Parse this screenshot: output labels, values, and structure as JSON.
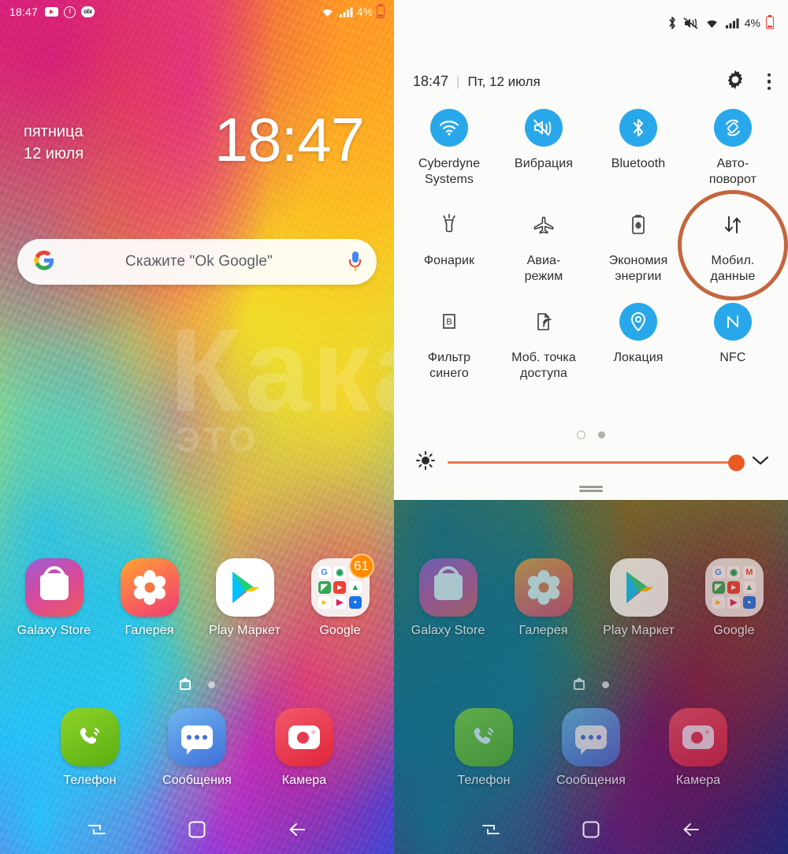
{
  "left_phone": {
    "status_bar": {
      "time": "18:47",
      "icons": [
        "youtube-icon",
        "clock-alarm-icon",
        "olx-icon"
      ],
      "olx_text": "olx",
      "right_icons": [
        "wifi-icon",
        "signal-icon"
      ],
      "battery_percent": "4%"
    },
    "clock_widget": {
      "weekday": "пятница",
      "date": "12 июля",
      "time": "18:47"
    },
    "search_bar": {
      "logo": "G",
      "placeholder": "Скажите \"Ok Google\"",
      "mic": "microphone-icon"
    },
    "apps_row1": [
      {
        "label": "Galaxy Store",
        "icon": "shopping-bag-icon"
      },
      {
        "label": "Галерея",
        "icon": "flower-icon"
      },
      {
        "label": "Play Маркет",
        "icon": "play-triangle-icon"
      },
      {
        "label": "Google",
        "icon": "folder-icon",
        "badge": "61"
      }
    ],
    "apps_row2": [
      {
        "label": "Телефон",
        "icon": "phone-handset-icon"
      },
      {
        "label": "Сообщения",
        "icon": "chat-bubble-icon"
      },
      {
        "label": "Камера",
        "icon": "camera-icon"
      }
    ],
    "folder_mini_icons": [
      "G",
      "C",
      "M",
      "Maps",
      "YT",
      "Drive",
      "Play",
      "Duo2",
      "Duo"
    ],
    "nav": [
      {
        "name": "recents-button",
        "glyph": "recents-icon"
      },
      {
        "name": "home-button",
        "glyph": "home-square-icon"
      },
      {
        "name": "back-button",
        "glyph": "back-arrow-icon"
      }
    ],
    "watermark": {
      "line1": "Кака",
      "line2": "ЭТО"
    }
  },
  "right_phone": {
    "status_bar": {
      "icons": [
        "bluetooth-icon",
        "mute-icon",
        "wifi-icon",
        "signal-icon"
      ],
      "battery_percent": "4%"
    },
    "panel_header": {
      "time": "18:47",
      "separator": "|",
      "date": "Пт, 12 июля",
      "settings_icon": "gear-icon",
      "more_icon": "more-vertical-icon"
    },
    "tiles": [
      {
        "label": "Cyberdyne\nSystems",
        "label_lines": [
          "Cyberdyne",
          "Systems"
        ],
        "icon": "wifi-icon",
        "state": "on"
      },
      {
        "label": "Вибрация",
        "label_lines": [
          "Вибрация"
        ],
        "icon": "vibrate-mute-icon",
        "state": "on"
      },
      {
        "label": "Bluetooth",
        "label_lines": [
          "Bluetooth"
        ],
        "icon": "bluetooth-icon",
        "state": "on"
      },
      {
        "label": "Авто-поворот",
        "label_lines": [
          "Авто-",
          "поворот"
        ],
        "icon": "auto-rotate-icon",
        "state": "on"
      },
      {
        "label": "Фонарик",
        "label_lines": [
          "Фонарик"
        ],
        "icon": "flashlight-icon",
        "state": "off"
      },
      {
        "label": "Авиа-режим",
        "label_lines": [
          "Авиа-",
          "режим"
        ],
        "icon": "airplane-icon",
        "state": "off"
      },
      {
        "label": "Экономия энергии",
        "label_lines": [
          "Экономия",
          "энергии"
        ],
        "icon": "power-saving-icon",
        "state": "off"
      },
      {
        "label": "Мобил. данные",
        "label_lines": [
          "Мобил.",
          "данные"
        ],
        "icon": "data-arrows-icon",
        "state": "off",
        "highlighted": true
      },
      {
        "label": "Фильтр синего",
        "label_lines": [
          "Фильтр",
          "синего"
        ],
        "icon": "blue-light-filter-icon",
        "state": "off"
      },
      {
        "label": "Моб. точка доступа",
        "label_lines": [
          "Моб. точка",
          "доступа"
        ],
        "icon": "hotspot-icon",
        "state": "off"
      },
      {
        "label": "Локация",
        "label_lines": [
          "Локация"
        ],
        "icon": "location-pin-icon",
        "state": "on"
      },
      {
        "label": "NFC",
        "label_lines": [
          "NFC"
        ],
        "icon": "nfc-icon",
        "state": "on"
      }
    ],
    "page_dots": {
      "count": 2,
      "active_index": 0
    },
    "brightness": {
      "icon": "brightness-icon",
      "value_percent": 100,
      "expand_icon": "chevron-down-icon"
    },
    "apps_row1": [
      {
        "label": "Galaxy Store"
      },
      {
        "label": "Галерея"
      },
      {
        "label": "Play Маркет"
      },
      {
        "label": "Google"
      }
    ],
    "apps_row2": [
      {
        "label": "Телефон"
      },
      {
        "label": "Сообщения"
      },
      {
        "label": "Камера"
      }
    ],
    "nav": [
      {
        "name": "recents-button"
      },
      {
        "name": "home-button"
      },
      {
        "name": "back-button"
      }
    ]
  },
  "colors": {
    "tile_active": "#28a8ea",
    "annotation_ring": "#c4663f",
    "slider": "#ec5a24",
    "badge": "#ff8a00",
    "panel_bg": "#fbfbf9"
  }
}
